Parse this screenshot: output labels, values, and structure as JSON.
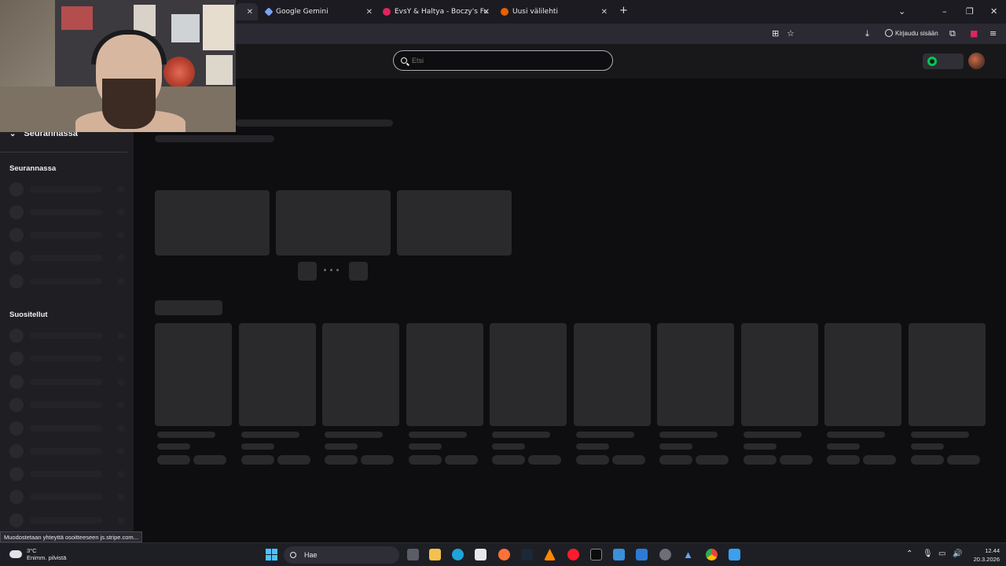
{
  "browser": {
    "tabs": [
      {
        "title": "Google Gemini",
        "favicon_color": "#7aa2f7"
      },
      {
        "title": "EvsY & Haltya - Boczy's Funky Q",
        "favicon_color": "#e0245e"
      },
      {
        "title": "Uusi välilehti",
        "favicon_color": "#e66000"
      }
    ],
    "new_tab_icon": "plus-icon",
    "signin_label": "Kirjaudu sisään"
  },
  "site": {
    "search_placeholder": "Etsi",
    "accent": "#00c853"
  },
  "sidebar": {
    "toggle_label": "Seurannassa",
    "section_following": "Seurannassa",
    "section_recommended": "Suositellut"
  },
  "status_url": "Muodostetaan yhteyttä osoitteeseen js.stripe.com...",
  "taskbar": {
    "weather_temp": "3°C",
    "weather_desc": "Enimm. pilvistä",
    "search_label": "Hae",
    "time": "12.44",
    "date": "20.3.2026"
  }
}
